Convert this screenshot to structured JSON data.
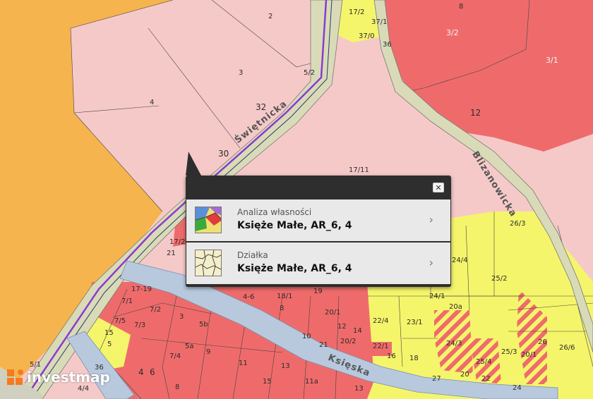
{
  "map": {
    "colors": {
      "orange_zone": "#f5b44d",
      "pink_zone": "#f6c9c9",
      "red_zone": "#ef6b6b",
      "yellow_zone": "#f5f56b",
      "road": "#d9dbb8",
      "street_blue": "#b8c9de",
      "route_purple": "#8a3bd0"
    },
    "streets": {
      "s1": "Świętnicka",
      "s2": "Blizanowicka",
      "s3": "Księska"
    },
    "parcel_labels": [
      "2",
      "3",
      "4",
      "32",
      "30",
      "5/2",
      "17/2",
      "37/1",
      "37/0",
      "36",
      "8",
      "3/2",
      "3/1",
      "12",
      "17/11",
      "17/2",
      "21",
      "17-19",
      "7/1",
      "7/2",
      "7/5",
      "7/3",
      "3",
      "5b",
      "5a",
      "7/4",
      "9",
      "4-6",
      "18/1",
      "19",
      "20/1",
      "8",
      "10",
      "12",
      "14",
      "21",
      "20/2",
      "22/4",
      "22/1",
      "16",
      "18",
      "23/1",
      "24/1",
      "20a",
      "24/3",
      "25/4",
      "20/1",
      "25/3",
      "25/2",
      "24/4",
      "26",
      "26/6",
      "26/3",
      "15",
      "5",
      "5/1",
      "36",
      "4/4",
      "4",
      "6",
      "8",
      "11",
      "13",
      "15",
      "11a",
      "13",
      "27",
      "20",
      "22",
      "24"
    ]
  },
  "popup": {
    "close_label": "✕",
    "items": [
      {
        "subtitle": "Analiza własności",
        "title": "Księże Małe, AR_6, 4",
        "icon": "ownership-analysis-icon"
      },
      {
        "subtitle": "Działka",
        "title": "Księże Małe, AR_6, 4",
        "icon": "parcel-icon"
      }
    ],
    "arrow": "›"
  },
  "logo": {
    "brand": "investmap"
  }
}
